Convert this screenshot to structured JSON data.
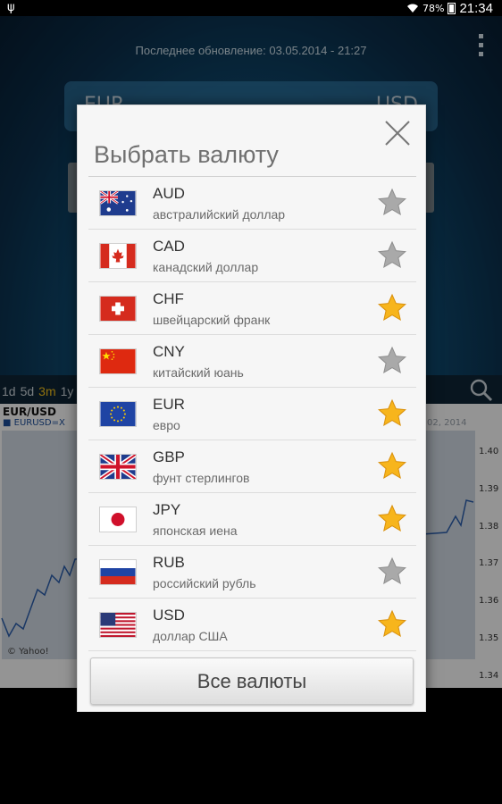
{
  "status_bar": {
    "battery": "78%",
    "time": "21:34"
  },
  "background_app": {
    "last_update": "Последнее обновление: 03.05.2014 - 21:27",
    "from_currency": "EUR",
    "to_currency": "USD",
    "ranges": [
      "1d",
      "5d",
      "3m",
      "1y"
    ],
    "selected_range": "3m",
    "chart": {
      "title": "EUR/USD",
      "legend": "EURUSD=X",
      "date_label": "02, 2014",
      "credit": "© Yahoo!",
      "y_ticks": [
        "1.40",
        "1.39",
        "1.38",
        "1.37",
        "1.36",
        "1.35",
        "1.34"
      ]
    }
  },
  "dialog": {
    "title": "Выбрать валюту",
    "all_currencies_label": "Все валюты",
    "currencies": [
      {
        "code": "AUD",
        "name": "австралийский доллар",
        "favorite": false,
        "flag": "au-flag"
      },
      {
        "code": "CAD",
        "name": "канадский доллар",
        "favorite": false,
        "flag": "ca-flag"
      },
      {
        "code": "CHF",
        "name": "швейцарский франк",
        "favorite": true,
        "flag": "ch-flag"
      },
      {
        "code": "CNY",
        "name": "китайский юань",
        "favorite": false,
        "flag": "cn-flag"
      },
      {
        "code": "EUR",
        "name": "евро",
        "favorite": true,
        "flag": "eu-flag"
      },
      {
        "code": "GBP",
        "name": "фунт стерлингов",
        "favorite": true,
        "flag": "gb-flag"
      },
      {
        "code": "JPY",
        "name": "японская иена",
        "favorite": true,
        "flag": "jp-flag"
      },
      {
        "code": "RUB",
        "name": "российский рубль",
        "favorite": false,
        "flag": "ru-flag"
      },
      {
        "code": "USD",
        "name": "доллар США",
        "favorite": true,
        "flag": "us-flag"
      }
    ]
  },
  "colors": {
    "star_on": "#f7b51c",
    "star_off": "#a9a9a9",
    "accent": "#f4c21b"
  }
}
